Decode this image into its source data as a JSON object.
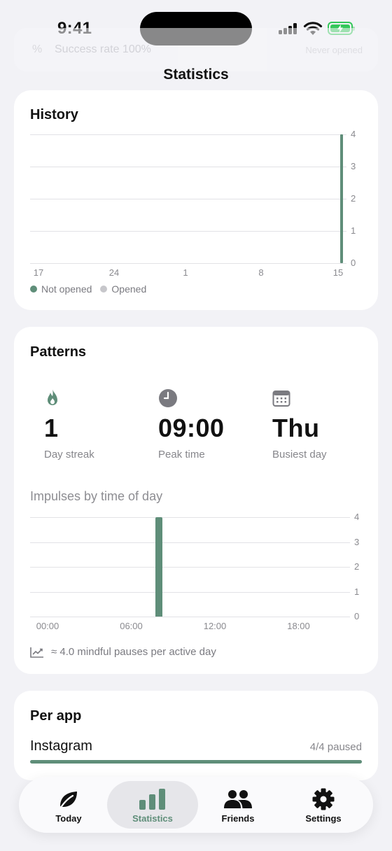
{
  "status_bar": {
    "time": "9:41"
  },
  "background_card": {
    "text": "Success rate 100%",
    "right_text": "Never opened"
  },
  "nav": {
    "title": "Statistics"
  },
  "history": {
    "title": "History",
    "legend": [
      {
        "label": "Not opened",
        "color": "#5f8e79"
      },
      {
        "label": "Opened",
        "color": "#c7c7cb"
      }
    ]
  },
  "patterns": {
    "title": "Patterns",
    "stats": [
      {
        "icon": "flame-icon",
        "value": "1",
        "label": "Day streak"
      },
      {
        "icon": "clock-icon",
        "value": "09:00",
        "label": "Peak time"
      },
      {
        "icon": "calendar-icon",
        "value": "Thu",
        "label": "Busiest day"
      }
    ],
    "chart_title": "Impulses by time of day",
    "footnote": "≈ 4.0 mindful pauses per active day"
  },
  "per_app": {
    "title": "Per app",
    "apps": [
      {
        "name": "Instagram",
        "status": "4/4 paused",
        "fraction": 1.0
      }
    ]
  },
  "tabs": [
    {
      "label": "Today",
      "icon": "leaf-icon",
      "active": false
    },
    {
      "label": "Statistics",
      "icon": "bar-chart-icon",
      "active": true
    },
    {
      "label": "Friends",
      "icon": "people-icon",
      "active": false
    },
    {
      "label": "Settings",
      "icon": "gear-icon",
      "active": false
    }
  ],
  "colors": {
    "accent": "#5f8e79",
    "background": "#f2f2f6",
    "card": "#ffffff"
  },
  "chart_data": [
    {
      "type": "bar",
      "title": "History",
      "x_tick_labels": [
        "17",
        "24",
        "1",
        "8",
        "15"
      ],
      "x": [
        "15"
      ],
      "series": [
        {
          "name": "Not opened",
          "values": [
            4
          ]
        },
        {
          "name": "Opened",
          "values": [
            0
          ]
        }
      ],
      "ylim": [
        0,
        4
      ],
      "y_ticks": [
        0,
        1,
        2,
        3,
        4
      ],
      "grid": true,
      "legend": "bottom-left"
    },
    {
      "type": "bar",
      "title": "Impulses by time of day",
      "x_tick_labels": [
        "00:00",
        "06:00",
        "12:00",
        "18:00"
      ],
      "x": [
        "08:00"
      ],
      "values": [
        4
      ],
      "ylim": [
        0,
        4
      ],
      "y_ticks": [
        0,
        1,
        2,
        3,
        4
      ],
      "grid": true
    }
  ]
}
